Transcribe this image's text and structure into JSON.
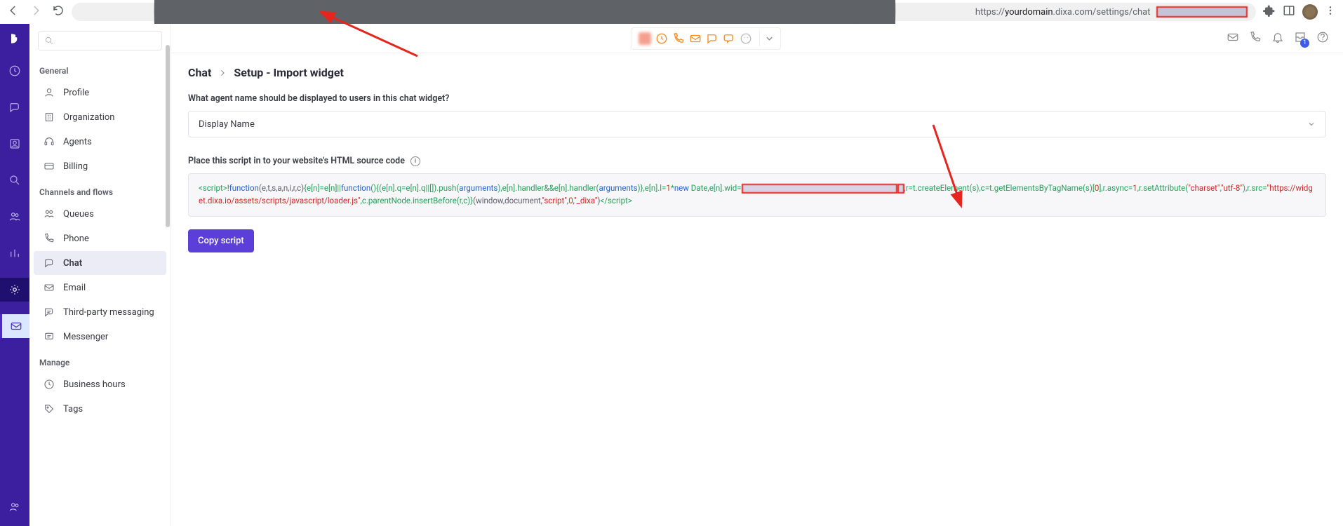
{
  "browser": {
    "url_prefix": "https://",
    "url_domain": "yourdomain",
    "url_path": ".dixa.com/settings/chat"
  },
  "rail": {},
  "sidebar": {
    "groups": [
      {
        "label": "General",
        "items": [
          {
            "name": "profile",
            "label": "Profile"
          },
          {
            "name": "organization",
            "label": "Organization"
          },
          {
            "name": "agents",
            "label": "Agents"
          },
          {
            "name": "billing",
            "label": "Billing"
          }
        ]
      },
      {
        "label": "Channels and flows",
        "items": [
          {
            "name": "queues",
            "label": "Queues"
          },
          {
            "name": "phone",
            "label": "Phone"
          },
          {
            "name": "chat",
            "label": "Chat",
            "active": true
          },
          {
            "name": "email",
            "label": "Email"
          },
          {
            "name": "third-party",
            "label": "Third-party messaging"
          },
          {
            "name": "messenger",
            "label": "Messenger"
          }
        ]
      },
      {
        "label": "Manage",
        "items": [
          {
            "name": "business-hours",
            "label": "Business hours"
          },
          {
            "name": "tags",
            "label": "Tags"
          }
        ]
      }
    ]
  },
  "topbar": {
    "badge_count": "1"
  },
  "breadcrumb": {
    "a": "Chat",
    "b": "Setup - Import widget"
  },
  "form": {
    "agent_name_label": "What agent name should be displayed to users in this chat widget?",
    "agent_name_value": "Display Name",
    "script_label": "Place this script in to your website's HTML source code",
    "copy_label": "Copy script"
  },
  "code": {
    "p1": "<script>",
    "p2": "!",
    "p3": "function",
    "p4": "(e,t,s,a,n,i,r,c)",
    "p5": "{e[n]=e[n]||",
    "p6": "function",
    "p7": "(){(e[n].q=e[n].q||[]).push(",
    "p8": "arguments",
    "p9": "),e[n].handler&&e[n].handler(",
    "p10": "arguments",
    "p11": ")},e[n].l=",
    "p12": "1",
    "p13": "*",
    "p14": "new",
    "p15": " Date,e[n].wid=",
    "p16": ",r=t.createElement(s),c=t.getElementsByTagName(s)[",
    "p17": "0",
    "p18": "],r.async=",
    "p19": "1",
    "p20": ",r.setAttribute(",
    "p21": "\"charset\"",
    "p22": ",",
    "p23": "\"utf-8\"",
    "p24": "),r.src=",
    "p25": "\"https://widget.dixa.io/assets/scripts/javascript/loader.js\"",
    "p26": ",c.parentNode.insertBefore(r,c)}",
    "p27": "(window,document,",
    "p28": "\"script\"",
    "p29": ",",
    "p30": "0",
    "p31": ",",
    "p32": "\"_dixa\"",
    "p33": ")",
    "p34": "</script>"
  }
}
